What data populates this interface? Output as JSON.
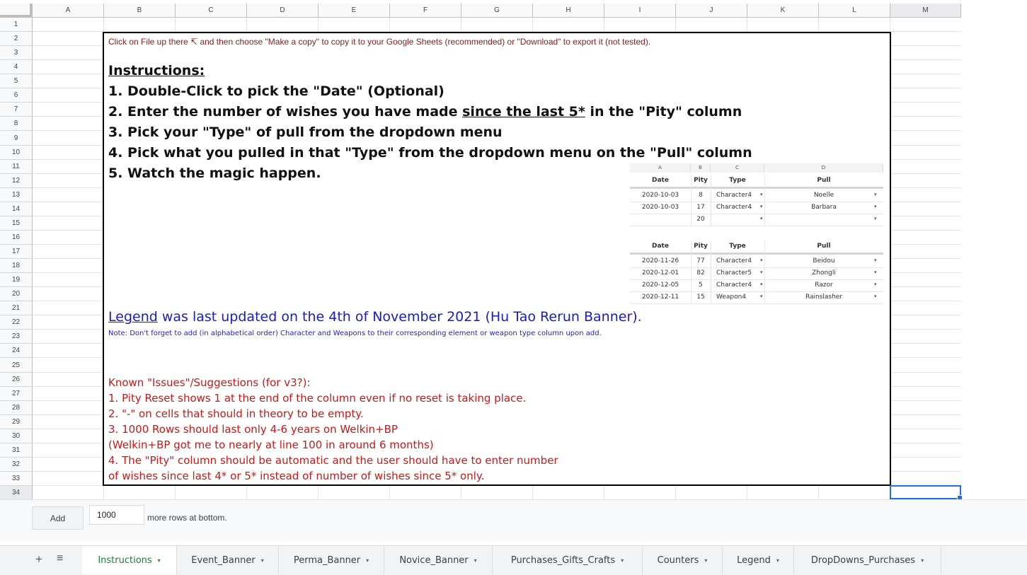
{
  "columns": [
    "A",
    "B",
    "C",
    "D",
    "E",
    "F",
    "G",
    "H",
    "I",
    "J",
    "K",
    "L",
    "M"
  ],
  "rows": [
    "1",
    "2",
    "3",
    "4",
    "5",
    "6",
    "7",
    "8",
    "9",
    "10",
    "11",
    "12",
    "13",
    "14",
    "15",
    "16",
    "17",
    "18",
    "19",
    "20",
    "21",
    "22",
    "23",
    "24",
    "25",
    "26",
    "27",
    "28",
    "29",
    "30",
    "31",
    "32",
    "33",
    "34"
  ],
  "panel": {
    "copy_note": "Click on File up there ↸ and then choose \"Make a copy\" to copy it to your Google Sheets (recommended) or \"Download\" to export it (not tested).",
    "instructions_title": "Instructions:",
    "step1": "1. Double-Click to pick the \"Date\" (Optional)",
    "step2_a": "2. Enter the number of wishes you have made ",
    "step2_u": "since the last 5*",
    "step2_b": " in the \"Pity\" column",
    "step3": "3. Pick your \"Type\" of pull from the dropdown menu",
    "step4": "4. Pick what you pulled in that \"Type\" from the dropdown menu on the \"Pull\" column",
    "step5": "5. Watch the magic happen.",
    "legend_link": "Legend",
    "legend_rest": " was last updated on the 4th of November 2021 (Hu Tao Rerun Banner).",
    "legend_note": "Note: Don't forget to add (in alphabetical order) Character and Weapons to their corresponding element or weapon type column upon add.",
    "known_issues": [
      "Known \"Issues\"/Suggestions (for v3?):",
      "1. Pity Reset shows 1 at the end of the column even if no reset is taking place.",
      "2. \"-\" on cells that should in theory to be empty.",
      "3. 1000 Rows should last only 4-6 years on Welkin+BP",
      "(Welkin+BP got me to nearly at line 100 in around 6 months)",
      "4. The \"Pity\" column should be automatic and the user should have to enter number",
      "of wishes since last 4* or 5* instead of number of wishes since 5* only."
    ]
  },
  "example1": {
    "col_letters": [
      "A",
      "B",
      "C",
      "D"
    ],
    "headers": [
      "Date",
      "Pity",
      "Type",
      "Pull"
    ],
    "rows": [
      [
        "2020-10-03",
        "8",
        "Character4",
        "Noelle"
      ],
      [
        "2020-10-03",
        "17",
        "Character4",
        "Barbara"
      ],
      [
        "",
        "20",
        "",
        ""
      ]
    ]
  },
  "example2": {
    "headers": [
      "Date",
      "Pity",
      "Type",
      "Pull"
    ],
    "rows": [
      [
        "2020-11-26",
        "77",
        "Character4",
        "Beidou"
      ],
      [
        "2020-12-01",
        "82",
        "Character5",
        "Zhongli"
      ],
      [
        "2020-12-05",
        "5",
        "Character4",
        "Razor"
      ],
      [
        "2020-12-11",
        "15",
        "Weapon4",
        "Rainslasher"
      ]
    ]
  },
  "add_rows": {
    "button": "Add",
    "value": "1000",
    "suffix": "more rows at bottom."
  },
  "tabs": [
    {
      "label": "Instructions",
      "active": true
    },
    {
      "label": "Event_Banner"
    },
    {
      "label": "Perma_Banner"
    },
    {
      "label": "Novice_Banner"
    },
    {
      "label": "Purchases_Gifts_Crafts"
    },
    {
      "label": "Counters"
    },
    {
      "label": "Legend"
    },
    {
      "label": "DropDowns_Purchases"
    }
  ],
  "icons": {
    "add_sheet": "+",
    "all_sheets": "≡",
    "dropdown": "▾"
  },
  "colors": {
    "active_tab": "#188038",
    "selection": "#1a73e8",
    "legend_text": "#1a1acc",
    "issues_text": "#d01515"
  }
}
